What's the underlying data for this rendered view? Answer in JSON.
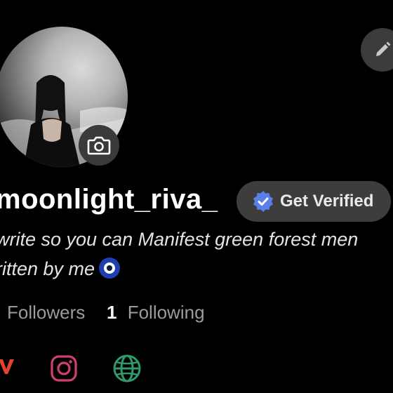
{
  "profile": {
    "username": "moonlight_riva_",
    "verify_button_label": "Get Verified",
    "bio_line1": "write so you can Manifest green forest men",
    "bio_line2": "ritten by me"
  },
  "stats": {
    "followers_label": "Followers",
    "following_count": "1",
    "following_label": "Following"
  },
  "icons": {
    "camera": "camera-icon",
    "edit": "pencil-icon",
    "verified": "verified-badge-icon",
    "social": [
      "tiktok-like-v-icon",
      "instagram-icon",
      "globe-icon"
    ],
    "emoji": "nazar-amulet-emoji"
  },
  "colors": {
    "background": "#000000",
    "button_bg": "#3d3d3d",
    "verified_badge": "#5b7fe8",
    "instagram": "#d0406f",
    "globe": "#2f9a6a",
    "v_icon": "#e0452c"
  }
}
